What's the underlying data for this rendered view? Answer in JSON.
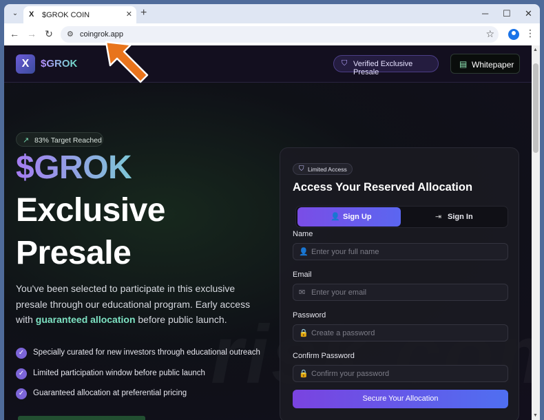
{
  "browser": {
    "tab_title": "$GROK COIN",
    "tab_favicon": "X",
    "url": "coingrok.app"
  },
  "header": {
    "logo_letter": "X",
    "brand": "$GROK",
    "verified_label": "Verified Exclusive Presale",
    "whitepaper_label": "Whitepaper"
  },
  "hero": {
    "target_badge": "83% Target Reached",
    "title_gradient": "$GROK",
    "title_line1": "Exclusive",
    "title_line2": "Presale",
    "desc_part1": "You've been selected to participate in this exclusive presale through our educational program. Early access with ",
    "desc_highlight": "guaranteed allocation",
    "desc_part2": " before public launch.",
    "features": [
      "Specially curated for new investors through educational outreach",
      "Limited participation window before public launch",
      "Guaranteed allocation at preferential pricing"
    ]
  },
  "card": {
    "badge": "Limited Access",
    "title": "Access Your Reserved Allocation",
    "tab_signup": "Sign Up",
    "tab_signin": "Sign In",
    "fields": {
      "name_label": "Name",
      "name_placeholder": "Enter your full name",
      "email_label": "Email",
      "email_placeholder": "Enter your email",
      "password_label": "Password",
      "password_placeholder": "Create a password",
      "confirm_label": "Confirm Password",
      "confirm_placeholder": "Confirm your password"
    },
    "submit": "Secure Your Allocation"
  },
  "watermark": "risk.com",
  "colors": {
    "accent_purple": "#7a4de6",
    "accent_teal": "#7ee3c3",
    "arrow_orange": "#e8741c"
  }
}
